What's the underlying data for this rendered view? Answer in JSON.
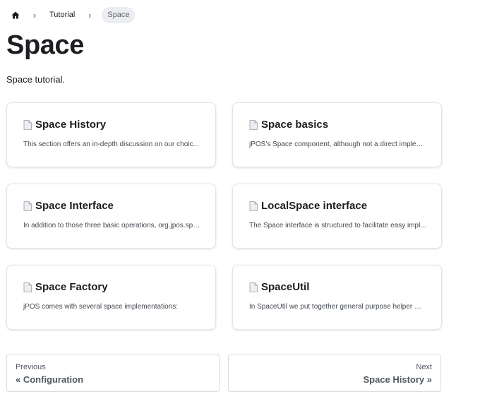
{
  "breadcrumb": {
    "home_icon": "home-icon",
    "separator": "›",
    "items": [
      {
        "label": "Tutorial"
      },
      {
        "label": "Space"
      }
    ]
  },
  "page": {
    "title": "Space",
    "intro": "Space tutorial."
  },
  "cards": [
    {
      "icon": "document-icon",
      "title": "Space History",
      "description": "This section offers an in-depth discussion on our choic..."
    },
    {
      "icon": "document-icon",
      "title": "Space basics",
      "description": "jPOS's Space component, although not a direct implem..."
    },
    {
      "icon": "document-icon",
      "title": "Space Interface",
      "description": "In addition to those three basic operations, org.jpos.spa..."
    },
    {
      "icon": "document-icon",
      "title": "LocalSpace interface",
      "description": "The Space interface is structured to facilitate easy impl..."
    },
    {
      "icon": "document-icon",
      "title": "Space Factory",
      "description": "jPOS comes with several space implementations:"
    },
    {
      "icon": "document-icon",
      "title": "SpaceUtil",
      "description": "In SpaceUtil we put together general purpose helper me..."
    }
  ],
  "pagination": {
    "previous": {
      "sublabel": "Previous",
      "label": "« Configuration"
    },
    "next": {
      "sublabel": "Next",
      "label": "Space History »"
    }
  }
}
